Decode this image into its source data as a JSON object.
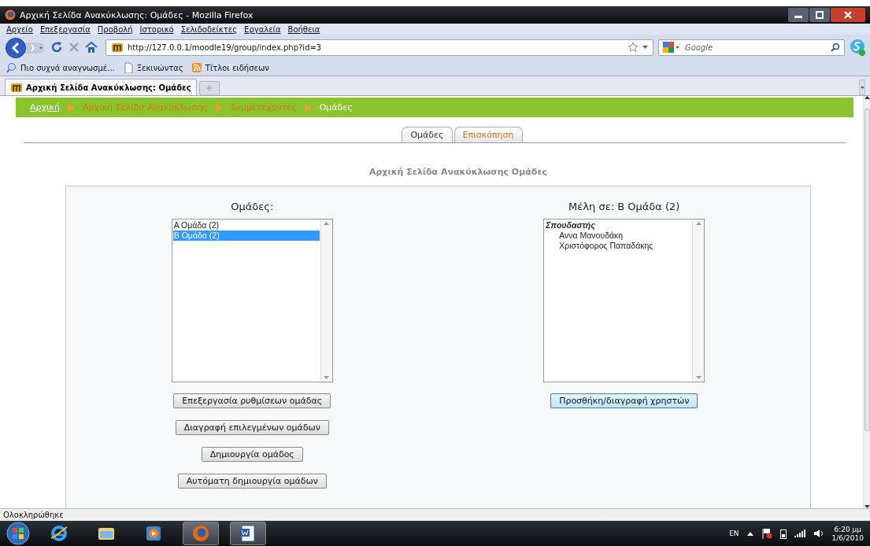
{
  "window": {
    "title": "Αρχική Σελίδα Ανακύκλωσης: Ομάδες - Mozilla Firefox"
  },
  "menu": [
    "Αρχείο",
    "Επεξεργασία",
    "Προβολή",
    "Ιστορικό",
    "Σελιδοδείκτες",
    "Εργαλεία",
    "Βοήθεια"
  ],
  "address": {
    "value": "http://127.0.0.1/moodle19/group/index.php?id=3"
  },
  "search": {
    "placeholder": "Google"
  },
  "bookmarks": [
    {
      "label": "Πιο συχνά αναγνωσμέ...",
      "kind": "most-visited"
    },
    {
      "label": "Ξεκινώντας",
      "kind": "page"
    },
    {
      "label": "Τίτλοι ειδήσεων",
      "kind": "feed"
    }
  ],
  "browser_tabs": [
    {
      "label": "Αρχική Σελίδα Ανακύκλωσης: Ομάδες",
      "selected": true
    }
  ],
  "breadcrumb": [
    {
      "label": "Αρχική",
      "kind": "home"
    },
    {
      "label": "Αρχική Σελίδα Ανακύκλωσης",
      "kind": "link"
    },
    {
      "label": "Συμμετέχοντες",
      "kind": "link"
    },
    {
      "label": "Ομάδες",
      "kind": "current"
    }
  ],
  "tabs": [
    {
      "label": "Ομάδες",
      "selected": true
    },
    {
      "label": "Επισκόπηση",
      "selected": false
    }
  ],
  "heading": "Αρχική Σελίδα Ανακύκλωσης Ομάδες",
  "groups_panel": {
    "title": "Ομάδες:",
    "items": [
      {
        "label": "Α Ομάδα (2)",
        "kind": "option",
        "selected": false
      },
      {
        "label": "Β Ομάδα (2)",
        "kind": "option",
        "selected": true
      }
    ],
    "buttons": [
      {
        "label": "Επεξεργασία ρυθμίσεων ομάδας",
        "focused": false
      },
      {
        "label": "Διαγραφή επιλεγμένων ομάδων",
        "focused": false
      },
      {
        "label": "Δημιουργία ομάδος",
        "focused": false
      },
      {
        "label": "Αυτόματη δημιουργία ομάδων",
        "focused": false
      }
    ]
  },
  "members_panel": {
    "title": "Μέλη σε: Β Ομάδα (2)",
    "items": [
      {
        "label": "Σπουδαστής",
        "kind": "role",
        "selected": false
      },
      {
        "label": "Αννα Μανουδάκη",
        "kind": "option",
        "selected": false
      },
      {
        "label": "Χριστόφορος Παπαδάκης",
        "kind": "option",
        "selected": false
      }
    ],
    "buttons": [
      {
        "label": "Προσθήκη/διαγραφή χρηστών",
        "focused": true
      }
    ]
  },
  "status_bar": {
    "text": "Ολοκληρώθηκε"
  },
  "taskbar": {
    "apps": [
      {
        "kind": "ie",
        "open": false
      },
      {
        "kind": "folder",
        "open": false
      },
      {
        "kind": "media",
        "open": false
      },
      {
        "kind": "firefox",
        "open": true
      },
      {
        "kind": "word",
        "open": true
      }
    ],
    "language": "EN",
    "time": "6:20 μμ",
    "date": "1/6/2010"
  }
}
